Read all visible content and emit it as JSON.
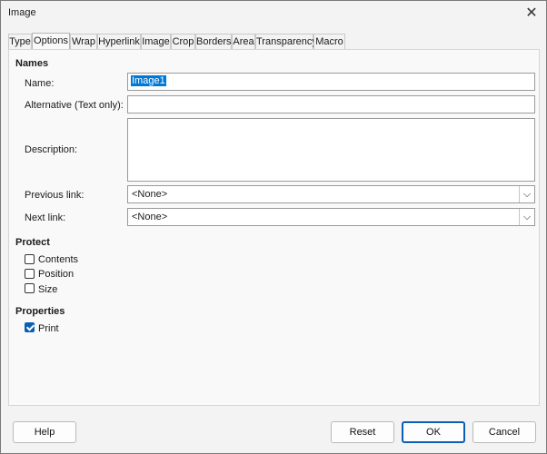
{
  "window": {
    "title": "Image"
  },
  "tabs": [
    "Type",
    "Options",
    "Wrap",
    "Hyperlink",
    "Image",
    "Crop",
    "Borders",
    "Area",
    "Transparency",
    "Macro"
  ],
  "active_tab": "Options",
  "names": {
    "title": "Names",
    "name_label": "Name:",
    "name_value": "Image1",
    "alt_label": "Alternative (Text only):",
    "alt_value": "",
    "desc_label": "Description:",
    "desc_value": "",
    "prev_label": "Previous link:",
    "prev_value": "<None>",
    "next_label": "Next link:",
    "next_value": "<None>"
  },
  "protect": {
    "title": "Protect",
    "contents": "Contents",
    "position": "Position",
    "size": "Size"
  },
  "properties": {
    "title": "Properties",
    "print": "Print"
  },
  "buttons": {
    "help": "Help",
    "reset": "Reset",
    "ok": "OK",
    "cancel": "Cancel"
  },
  "colors": {
    "accent": "#0a5fb4",
    "background": "#f3f3f3"
  }
}
